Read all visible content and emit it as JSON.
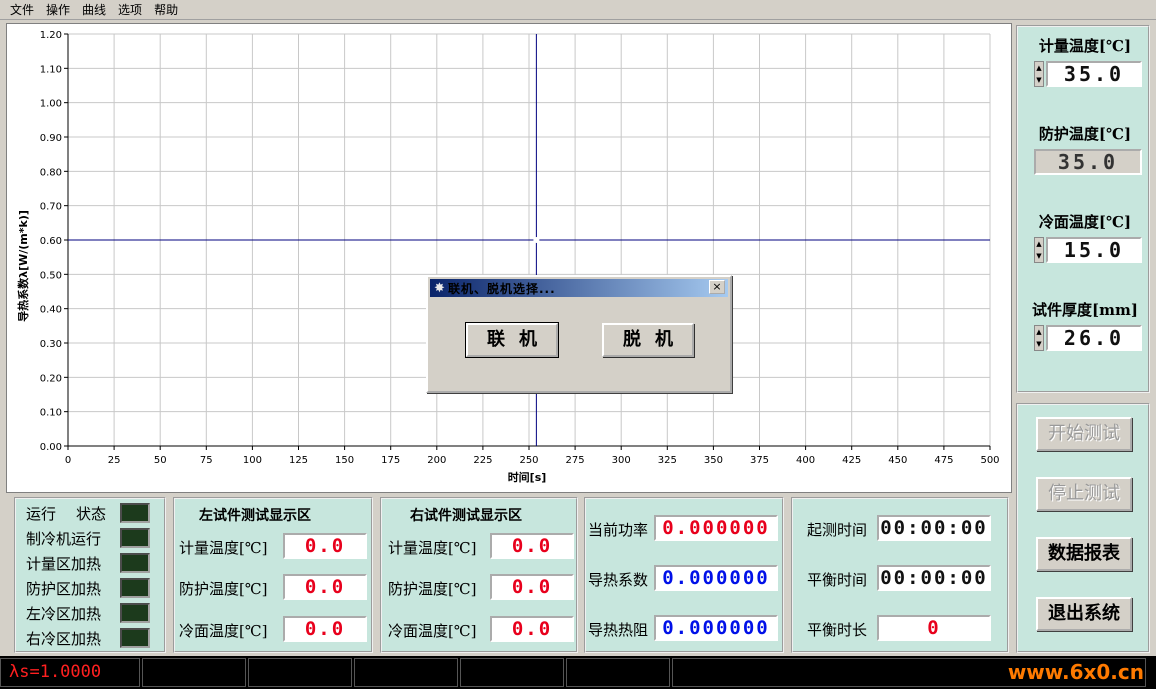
{
  "menu": [
    "文件",
    "操作",
    "曲线",
    "选项",
    "帮助"
  ],
  "chart_data": {
    "type": "line",
    "xlabel": "时间[s]",
    "ylabel": "导热系数λ[W/(m*k)]",
    "xlim": [
      0,
      500
    ],
    "ylim": [
      0,
      1.2
    ],
    "x_ticks": [
      "0",
      "25",
      "50",
      "75",
      "100",
      "125",
      "150",
      "175",
      "200",
      "225",
      "250",
      "275",
      "300",
      "325",
      "350",
      "375",
      "400",
      "425",
      "450",
      "475",
      "500"
    ],
    "y_ticks": [
      "0.00",
      "0.10",
      "0.20",
      "0.30",
      "0.40",
      "0.50",
      "0.60",
      "0.70",
      "0.80",
      "0.90",
      "1.00",
      "1.10",
      "1.20"
    ],
    "grid": true,
    "cursor": {
      "x": 254,
      "y": 0.6
    },
    "series": []
  },
  "params": {
    "meter_temp_label": "计量温度[℃]",
    "meter_temp_value": "35.0",
    "guard_temp_label": "防护温度[℃]",
    "guard_temp_value": "35.0",
    "cold_temp_label": "冷面温度[℃]",
    "cold_temp_value": "15.0",
    "thickness_label": "试件厚度[mm]",
    "thickness_value": "26.0"
  },
  "buttons": {
    "start": "开始测试",
    "stop": "停止测试",
    "report": "数据报表",
    "exit": "退出系统"
  },
  "status": {
    "header_run": "运行",
    "header_state": "状态",
    "items": [
      "制冷机运行",
      "计量区加热",
      "防护区加热",
      "左冷区加热",
      "右冷区加热"
    ]
  },
  "left_sample": {
    "title": "左试件测试显示区",
    "rows": [
      {
        "label": "计量温度[℃]",
        "value": "0.0"
      },
      {
        "label": "防护温度[℃]",
        "value": "0.0"
      },
      {
        "label": "冷面温度[℃]",
        "value": "0.0"
      }
    ]
  },
  "right_sample": {
    "title": "右试件测试显示区",
    "rows": [
      {
        "label": "计量温度[℃]",
        "value": "0.0"
      },
      {
        "label": "防护温度[℃]",
        "value": "0.0"
      },
      {
        "label": "冷面温度[℃]",
        "value": "0.0"
      }
    ]
  },
  "measure": {
    "power_label": "当前功率",
    "power_value": "0.000000",
    "conductivity_label": "导热系数",
    "conductivity_value": "0.000000",
    "resistance_label": "导热热阻",
    "resistance_value": "0.000000"
  },
  "timing": {
    "start_label": "起测时间",
    "start_value": "00:00:00",
    "balance_label": "平衡时间",
    "balance_value": "00:00:00",
    "duration_label": "平衡时长",
    "duration_value": "0"
  },
  "statusbar": {
    "lambda_text": "λs=1.0000",
    "watermark": "www.6x0.cn"
  },
  "dialog": {
    "title": "联机、脱机选择...",
    "online": "联机",
    "offline": "脱机",
    "close": "×"
  },
  "colors": {
    "panel_bg": "#c7e6dd",
    "digit_red": "#e8001c",
    "digit_blue": "#0010e8",
    "cursor_line": "#00007f"
  }
}
